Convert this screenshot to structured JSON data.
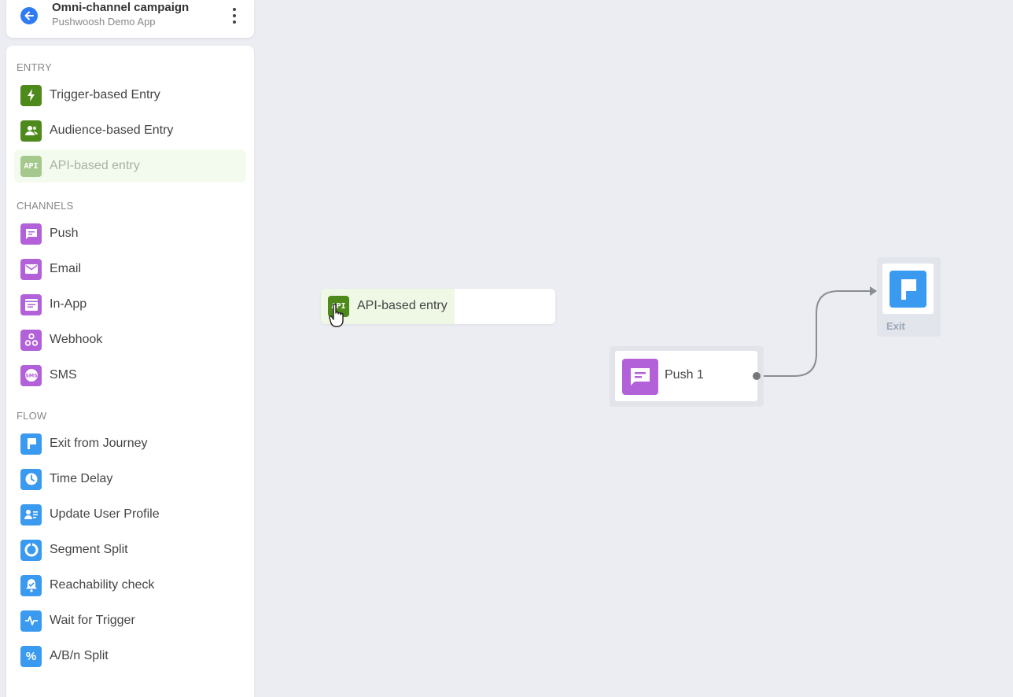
{
  "header": {
    "title": "Omni-channel campaign",
    "subtitle": "Pushwoosh Demo App"
  },
  "sidebar": {
    "entry_label": "ENTRY",
    "entry_items": [
      {
        "label": "Trigger-based Entry",
        "icon": "lightning-icon"
      },
      {
        "label": "Audience-based Entry",
        "icon": "users-icon"
      },
      {
        "label": "API-based entry",
        "icon": "api-icon"
      }
    ],
    "channels_label": "CHANNELS",
    "channel_items": [
      {
        "label": "Push",
        "icon": "push-message-icon"
      },
      {
        "label": "Email",
        "icon": "envelope-icon"
      },
      {
        "label": "In-App",
        "icon": "in-app-icon"
      },
      {
        "label": "Webhook",
        "icon": "webhook-icon"
      },
      {
        "label": "SMS",
        "icon": "sms-icon"
      }
    ],
    "flow_label": "FLOW",
    "flow_items": [
      {
        "label": "Exit from Journey",
        "icon": "flag-icon"
      },
      {
        "label": "Time Delay",
        "icon": "clock-icon"
      },
      {
        "label": "Update User Profile",
        "icon": "user-profile-icon"
      },
      {
        "label": "Segment Split",
        "icon": "pie-split-icon"
      },
      {
        "label": "Reachability check",
        "icon": "bell-check-icon"
      },
      {
        "label": "Wait for Trigger",
        "icon": "pulse-icon"
      },
      {
        "label": "A/B/n Split",
        "icon": "percent-icon"
      }
    ]
  },
  "canvas": {
    "dragging_node": {
      "label": "API-based entry",
      "icon_text": "API"
    },
    "push_node": {
      "label": "Push 1"
    },
    "exit_node": {
      "label": "Exit"
    }
  },
  "colors": {
    "entry_green": "#4e8a1b",
    "channel_purple": "#b261d8",
    "flow_blue": "#3a9af0",
    "back_blue": "#2f7bf5",
    "canvas_bg": "#ebedf3"
  }
}
